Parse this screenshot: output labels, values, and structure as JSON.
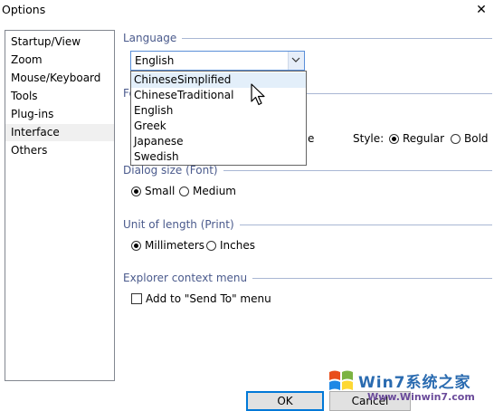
{
  "window": {
    "title": "Options",
    "close_glyph": "✕"
  },
  "nav": {
    "items": [
      {
        "label": "Startup/View",
        "selected": false
      },
      {
        "label": "Zoom",
        "selected": false
      },
      {
        "label": "Mouse/Keyboard",
        "selected": false
      },
      {
        "label": "Tools",
        "selected": false
      },
      {
        "label": "Plug-ins",
        "selected": false
      },
      {
        "label": "Interface",
        "selected": true
      },
      {
        "label": "Others",
        "selected": false
      }
    ]
  },
  "language": {
    "label": "Language",
    "selected": "English",
    "options": [
      "ChineseSimplified",
      "ChineseTraditional",
      "English",
      "Greek",
      "Japanese",
      "Swedish"
    ],
    "hovered_option": "ChineseSimplified"
  },
  "font": {
    "label_partial": "Fo",
    "name_tail": "e",
    "style_label": "Style:",
    "style_options": [
      "Regular",
      "Bold"
    ],
    "style_selected": "Regular"
  },
  "dialog_size": {
    "label": "Dialog size (Font)",
    "options": [
      "Small",
      "Medium"
    ],
    "selected": "Small"
  },
  "unit_of_length": {
    "label": "Unit of length (Print)",
    "options": [
      "Millimeters",
      "Inches"
    ],
    "selected": "Millimeters"
  },
  "explorer_menu": {
    "label": "Explorer context menu",
    "send_to_label": "Add to \"Send To\" menu",
    "send_to_checked": false
  },
  "buttons": {
    "ok": "OK",
    "cancel": "Cancel"
  },
  "watermark": {
    "text": "Win7系统之家",
    "url": "Www.Winwin7.com"
  },
  "colors": {
    "group_label": "#4a5a8c",
    "accent": "#0078d7"
  }
}
